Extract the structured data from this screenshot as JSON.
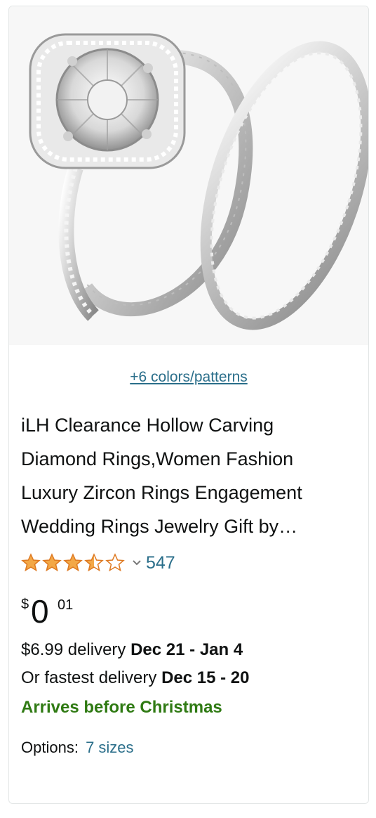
{
  "product": {
    "swatch_link": "+6 colors/patterns",
    "title_line1": "iLH Clearance Hollow Carving",
    "title_line2": "Diamond Rings,Women Fashion",
    "title_line3": "Luxury Zircon Rings Engagement",
    "title_line4": "Wedding Rings Jewelry Gift by…",
    "rating": 3.5,
    "review_count": "547",
    "price_symbol": "$",
    "price_whole": "0",
    "price_fraction": "01",
    "delivery": {
      "cost": "$6.99 delivery ",
      "dates": "Dec 21 - Jan 4",
      "fastest_prefix": "Or fastest delivery ",
      "fastest_dates": "Dec 15 - 20",
      "arrives": "Arrives before Christmas"
    },
    "options_label": "Options:",
    "options_value": "7 sizes"
  },
  "colors": {
    "star": "#f3a847",
    "link": "#2a6e8a",
    "arrives": "#2f7a13"
  },
  "icons": [
    "star-icon",
    "chevron-down-icon",
    "rings-image"
  ]
}
